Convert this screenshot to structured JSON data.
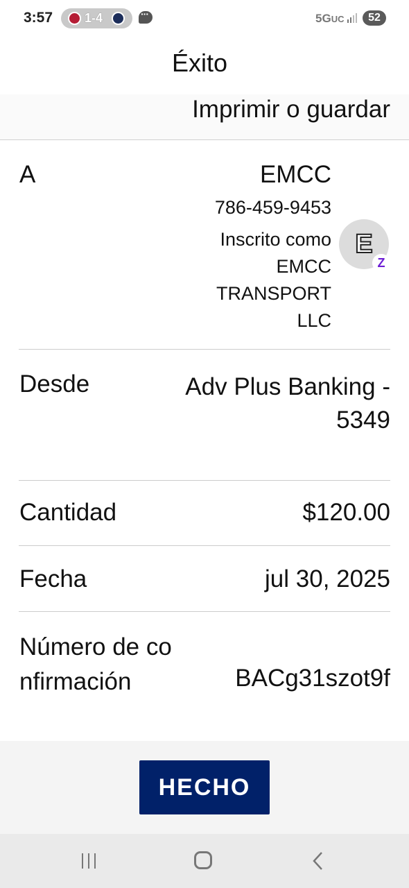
{
  "status_bar": {
    "time": "3:57",
    "score": "1-4",
    "network": "5G",
    "network_suffix": "UC",
    "battery": "52"
  },
  "header": {
    "title": "Éxito"
  },
  "actions": {
    "print_save": "Imprimir o guardar"
  },
  "details": {
    "to": {
      "label": "A",
      "name": "EMCC",
      "phone": "786-459-9453",
      "enrolled": "Inscrito como EMCC TRANSPORT LLC",
      "avatar_letter": "E",
      "badge": "Z"
    },
    "from": {
      "label": "Desde",
      "value": "Adv Plus Banking - 5349"
    },
    "amount": {
      "label": "Cantidad",
      "value": "$120.00"
    },
    "date": {
      "label": "Fecha",
      "value": "jul 30, 2025"
    },
    "confirmation": {
      "label": "Número de confirmación",
      "value": "BACg31szot9f"
    }
  },
  "footer": {
    "done_label": "HECHO"
  },
  "colors": {
    "primary_button": "#012169",
    "zelle_purple": "#6d1ed4",
    "divider": "#cccccc"
  }
}
